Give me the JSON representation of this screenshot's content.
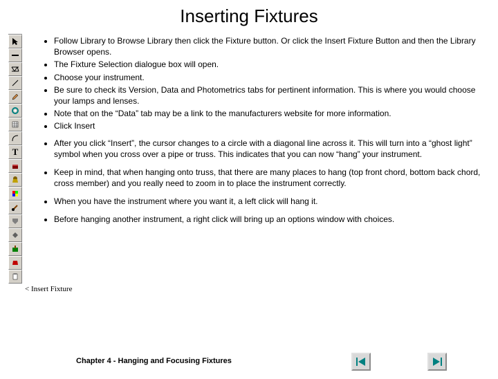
{
  "title": "Inserting Fixtures",
  "bullets_group1": [
    "Follow Library to Browse Library then click the Fixture button. Or click the Insert Fixture Button and then the Library Browser opens.",
    "The Fixture Selection dialogue box will open.",
    "Choose your instrument.",
    "Be sure to check its Version, Data and Photometrics tabs for pertinent information. This is where you would choose your lamps and lenses.",
    "Note that on the “Data” tab may be a link to the manufacturers website for more information.",
    "Click Insert"
  ],
  "bullets_group2": [
    "After you click “Insert”, the cursor changes to a circle with a diagonal line across it. This will turn into a “ghost light” symbol when you cross over a pipe or truss. This indicates that you can now “hang” your instrument.",
    "Keep in mind, that when hanging onto truss, that there are many places to hang (top front chord, bottom back chord, cross member) and you really need to zoom in to place the instrument correctly.",
    "When you have the instrument where you want it, a left click will hang it.",
    "Before hanging another instrument, a right click will bring up an options window with choices."
  ],
  "fixture_label": "< Insert Fixture",
  "footer": "Chapter 4 - Hanging and Focusing Fixtures",
  "toolbar": [
    {
      "name": "arrow-icon"
    },
    {
      "name": "pipe-icon"
    },
    {
      "name": "truss-icon"
    },
    {
      "name": "line-icon"
    },
    {
      "name": "pencil-icon"
    },
    {
      "name": "gear-icon"
    },
    {
      "name": "calendar-icon"
    },
    {
      "name": "arc-icon"
    },
    {
      "name": "text-icon",
      "label": "T"
    },
    {
      "name": "riser-icon"
    },
    {
      "name": "lamp-icon"
    },
    {
      "name": "color-icon"
    },
    {
      "name": "brush-icon"
    },
    {
      "name": "shape1-icon"
    },
    {
      "name": "shape2-icon"
    },
    {
      "name": "paint1-icon"
    },
    {
      "name": "paint2-icon"
    },
    {
      "name": "clipboard-icon"
    }
  ]
}
